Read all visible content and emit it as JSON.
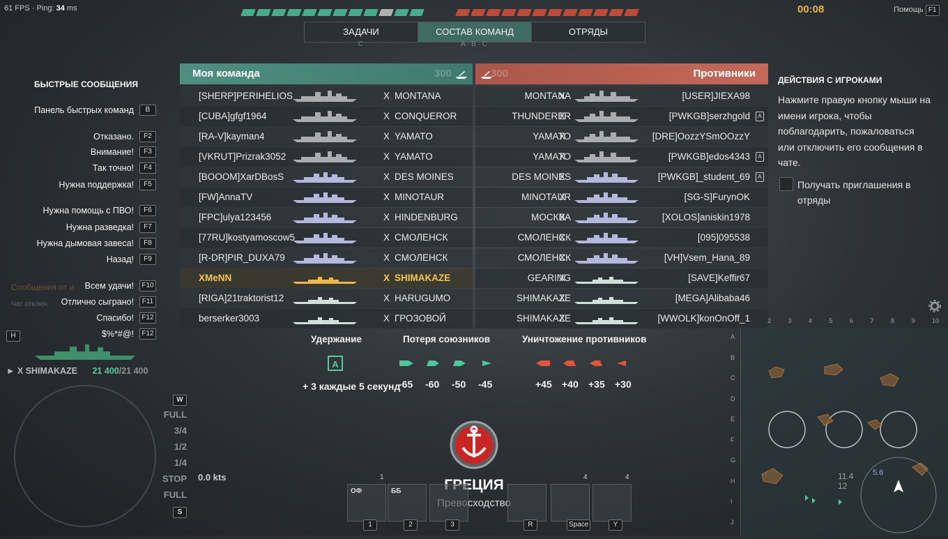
{
  "hud": {
    "fps_label": "61 FPS · Ping:",
    "ping": "34",
    "ping_unit": "ms",
    "timer": "00:08",
    "help_label": "Помощь",
    "help_key": "F1"
  },
  "tabs": [
    {
      "label": "ЗАДАЧИ",
      "sub": "С"
    },
    {
      "label": "СОСТАВ КОМАНД",
      "sub": "A · B · C"
    },
    {
      "label": "ОТРЯДЫ",
      "sub": ""
    }
  ],
  "quick_messages": {
    "title": "БЫСТРЫЕ СООБЩЕНИЯ",
    "items": [
      {
        "label": "Панель быстрых команд",
        "key": "B"
      },
      {
        "label": "Отказано.",
        "key": "F2"
      },
      {
        "label": "Внимание!",
        "key": "F3"
      },
      {
        "label": "Так точно!",
        "key": "F4"
      },
      {
        "label": "Нужна поддержка!",
        "key": "F5"
      },
      {
        "label": "Нужна помощь с ПВО!",
        "key": "F6"
      },
      {
        "label": "Нужна разведка!",
        "key": "F7"
      },
      {
        "label": "Нужна дымовая завеса!",
        "key": "F8"
      },
      {
        "label": "Назад!",
        "key": "F9"
      },
      {
        "label": "Всем удачи!",
        "key": "F10"
      },
      {
        "label": "Отлично сыграно!",
        "key": "F11"
      },
      {
        "label": "Спасибо!",
        "key": "F12"
      },
      {
        "label": "$%*#@!",
        "key": "F12"
      }
    ],
    "faded_1": "Сообщения от и",
    "faded_2": "Чат отключ"
  },
  "own_ship": {
    "hotkey": "H",
    "tier": "X",
    "name": "SHIMAKAZE",
    "hp": "21 400",
    "hp_max": "/21 400",
    "throttle": [
      "W",
      "FULL",
      "3/4",
      "1/2",
      "1/4",
      "STOP",
      "FULL",
      "S"
    ],
    "speed": "0.0 kts"
  },
  "my_team": {
    "title": "Моя команда",
    "score": "300",
    "players": [
      {
        "player": "[SHERP]PERIHELIOS",
        "tier": "X",
        "ship": "MONTANA",
        "cls": "bb"
      },
      {
        "player": "[CUBA]gfgf1964",
        "tier": "X",
        "ship": "CONQUEROR",
        "cls": "bb"
      },
      {
        "player": "[RA-V]kayman4",
        "tier": "X",
        "ship": "YAMATO",
        "cls": "bb"
      },
      {
        "player": "[VKRUT]Prizrak3052",
        "tier": "X",
        "ship": "YAMATO",
        "cls": "bb"
      },
      {
        "player": "[BOOOM]XarDBosS",
        "tier": "X",
        "ship": "DES MOINES",
        "cls": "ca"
      },
      {
        "player": "[FW]AnnaTV",
        "tier": "X",
        "ship": "MINOTAUR",
        "cls": "ca"
      },
      {
        "player": "[FPC]ulya123456",
        "tier": "X",
        "ship": "HINDENBURG",
        "cls": "ca"
      },
      {
        "player": "[77RU]kostyamoscow5",
        "tier": "X",
        "ship": "СМОЛЕНСК",
        "cls": "ca"
      },
      {
        "player": "[R-DR]PIR_DUXA79",
        "tier": "X",
        "ship": "СМОЛЕНСК",
        "cls": "ca"
      },
      {
        "player": "XMeNN",
        "tier": "X",
        "ship": "SHIMAKAZE",
        "cls": "dd",
        "me": true
      },
      {
        "player": "[RIGA]21traktorist12",
        "tier": "X",
        "ship": "HARUGUMO",
        "cls": "dd"
      },
      {
        "player": "berserker3003",
        "tier": "X",
        "ship": "ГРОЗОВОЙ",
        "cls": "dd"
      }
    ]
  },
  "enemy_team": {
    "title": "Противники",
    "score": "300",
    "players": [
      {
        "player": "[USER]JIEXA98",
        "tier": "X",
        "ship": "MONTANA",
        "cls": "bb",
        "division": ""
      },
      {
        "player": "[PWKGB]serzhgold",
        "tier": "X",
        "ship": "THUNDERER",
        "cls": "bb",
        "division": "A"
      },
      {
        "player": "[DRE]OozzYSmOOzzY",
        "tier": "X",
        "ship": "YAMATO",
        "cls": "bb",
        "division": ""
      },
      {
        "player": "[PWKGB]edos4343",
        "tier": "X",
        "ship": "YAMATO",
        "cls": "bb",
        "division": "A"
      },
      {
        "player": "[PWKGB]_student_69",
        "tier": "X",
        "ship": "DES MOINES",
        "cls": "ca",
        "division": "A"
      },
      {
        "player": "[SG-S]FurynOK",
        "tier": "X",
        "ship": "MINOTAUR",
        "cls": "ca",
        "division": ""
      },
      {
        "player": "[XOLOS]aniskin1978",
        "tier": "X",
        "ship": "МОСКВА",
        "cls": "ca",
        "division": ""
      },
      {
        "player": "[095]095538",
        "tier": "X",
        "ship": "СМОЛЕНСК",
        "cls": "ca",
        "division": ""
      },
      {
        "player": "[VH]Vsem_Hana_89",
        "tier": "X",
        "ship": "СМОЛЕНСК",
        "cls": "ca",
        "division": ""
      },
      {
        "player": "[SAVE]Keffir67",
        "tier": "X",
        "ship": "GEARING",
        "cls": "dd",
        "division": ""
      },
      {
        "player": "[MEGA]Alibaba46",
        "tier": "X",
        "ship": "SHIMAKAZE",
        "cls": "dd",
        "division": ""
      },
      {
        "player": "[WWOLK]konOnOff_1",
        "tier": "X",
        "ship": "SHIMAKAZE",
        "cls": "dd",
        "division": ""
      }
    ]
  },
  "player_actions": {
    "title": "ДЕЙСТВИЯ С ИГРОКАМИ",
    "text": "Нажмите правую кнопку мыши на имени игрока, чтобы поблагодарить, пожаловаться или отключить его сообщения в чате.",
    "checkbox_label": "Получать приглашения в отряды",
    "checkbox_checked": false
  },
  "scoring": {
    "hold_title": "Удержание",
    "hold_badge": "A",
    "hold_value": "+ 3 каждые 5 секунд",
    "loss_title": "Потеря союзников",
    "loss_values": [
      "-65",
      "-60",
      "-50",
      "-45"
    ],
    "kill_title": "Уничтожение противников",
    "kill_values": [
      "+45",
      "+40",
      "+35",
      "+30"
    ]
  },
  "map": {
    "name": "ГРЕЦИЯ",
    "mode": "Превосходство",
    "minimap_cols": [
      "2",
      "3",
      "4",
      "5",
      "6",
      "7",
      "8",
      "9",
      "10"
    ],
    "minimap_rows": [
      "A",
      "B",
      "C",
      "D",
      "E",
      "F",
      "G",
      "H",
      "I",
      "J"
    ],
    "readout_1": "11.4",
    "readout_2": "12",
    "readout_3": "5.6"
  },
  "consumables": [
    {
      "label": "ОФ",
      "num": "1",
      "key": "1"
    },
    {
      "label": "ББ",
      "num": "",
      "key": "2"
    },
    {
      "label": "",
      "num": "",
      "key": "3"
    },
    {
      "label": "",
      "num": "",
      "key": "R"
    },
    {
      "label": "",
      "num": "4",
      "key": "Space"
    },
    {
      "label": "",
      "num": "4",
      "key": "Y"
    }
  ],
  "colors": {
    "ally": "#4f8f81",
    "enemy": "#c4695a",
    "self": "#f3c45a",
    "timer": "#e3b64a"
  }
}
